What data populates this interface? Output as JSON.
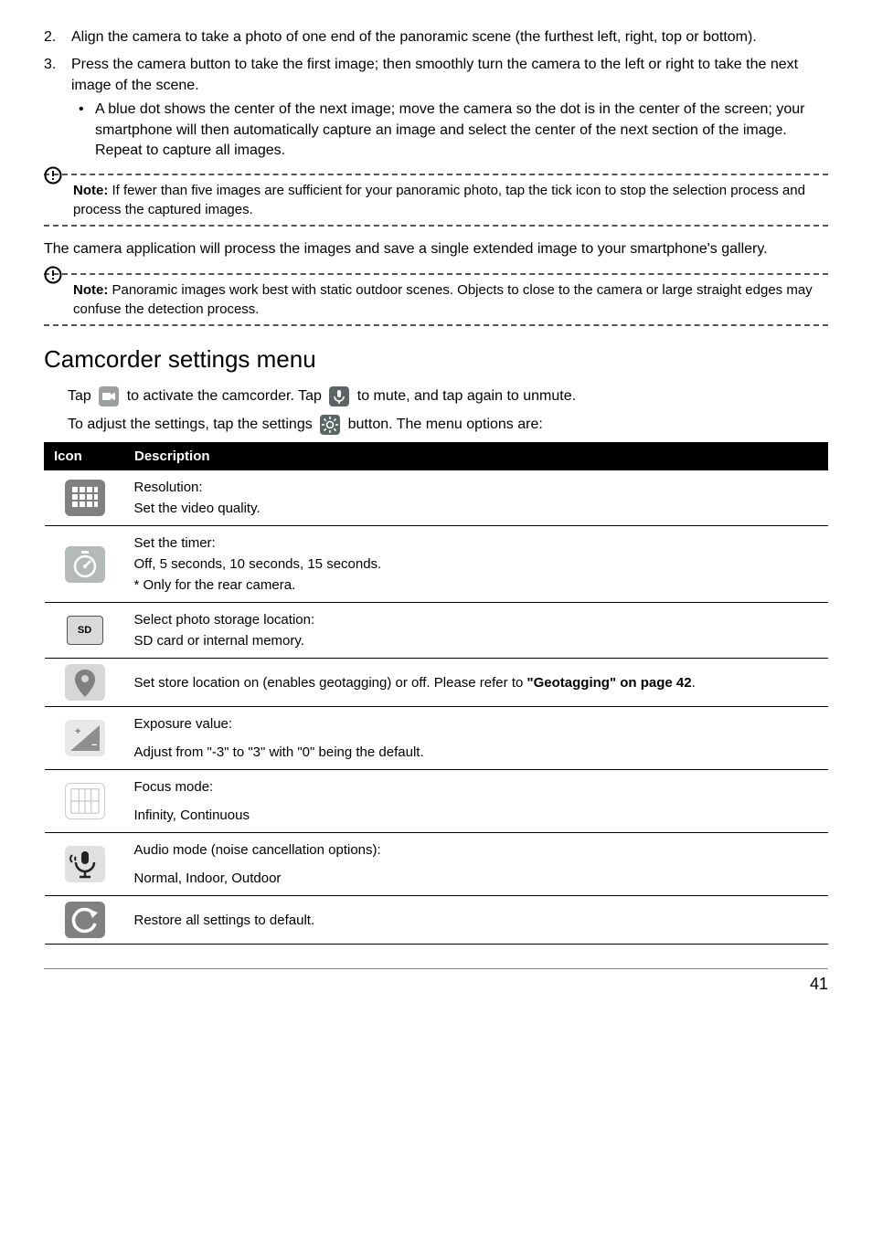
{
  "steps": [
    {
      "num": "2.",
      "text": "Align the camera to take a photo of one end of the panoramic scene (the furthest left, right, top or bottom)."
    },
    {
      "num": "3.",
      "text": "Press the camera button to take the first image; then smoothly turn the camera to the left or right to take the next image of the scene.",
      "bullets": [
        "A blue dot shows the center of the next image; move the camera so the dot is in the center of the screen; your smartphone will then automatically capture an image and select the center of the next section of the image. Repeat to capture all images."
      ]
    }
  ],
  "note1": {
    "label": "Note:",
    "text": " If fewer than five images are sufficient for your panoramic photo, tap the tick icon to stop the selection process and process the captured images."
  },
  "body_para": "The camera application will process the images and save a single extended image to your smartphone's gallery.",
  "note2": {
    "label": "Note:",
    "text": " Panoramic images work best with static outdoor scenes. Objects to close to the camera or large straight edges may confuse the detection process."
  },
  "heading": "Camcorder settings menu",
  "inline1": {
    "pre": "Tap ",
    "mid": " to activate the camcorder. Tap ",
    "post": " to mute, and tap again to unmute."
  },
  "inline2": {
    "pre": "To adjust the settings, tap the settings ",
    "post": " button. The menu options are:"
  },
  "table": {
    "headers": {
      "icon": "Icon",
      "desc": "Description"
    },
    "rows": [
      {
        "l1": "Resolution:",
        "l2": "Set the video quality."
      },
      {
        "l1": "Set the timer:",
        "l2": "Off, 5 seconds, 10 seconds, 15 seconds.",
        "l3": "* Only for the rear camera."
      },
      {
        "l1": "Select photo storage location:",
        "l2": "SD card or internal memory."
      },
      {
        "pre": "Set store location on (enables geotagging) or off. Please refer to ",
        "bold": "\"Geotagging\" on page 42",
        "post": "."
      },
      {
        "l1": "Exposure value:",
        "l2": "Adjust from \"-3\" to \"3\" with \"0\" being the default."
      },
      {
        "l1": "Focus mode:",
        "l2": "Infinity, Continuous"
      },
      {
        "l1": "Audio mode (noise cancellation options):",
        "l2": "Normal, Indoor, Outdoor"
      },
      {
        "l1": "Restore all settings to default."
      }
    ]
  },
  "page_num": "41"
}
